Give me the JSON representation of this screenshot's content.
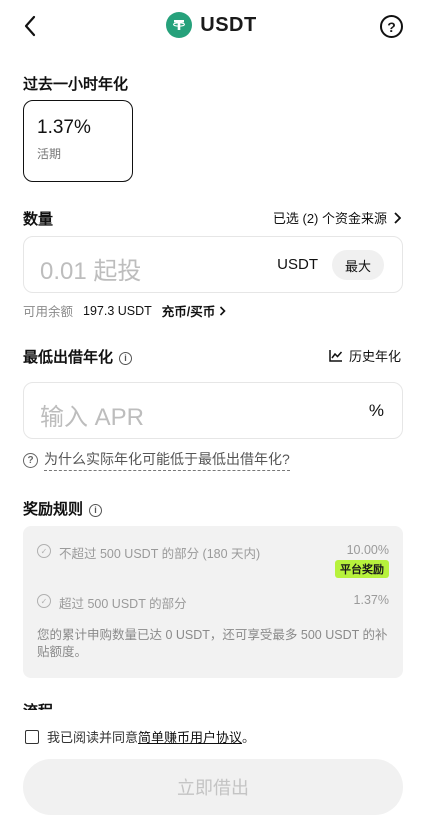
{
  "header": {
    "title": "USDT",
    "back_icon": "chevron-left-icon",
    "help_icon": "question-circle-icon",
    "help_glyph": "?",
    "coin_icon": "tether-coin-icon"
  },
  "past_hour": {
    "label": "过去一小时年化",
    "rate": "1.37%",
    "rate_type": "活期"
  },
  "amount": {
    "label": "数量",
    "sources_text": "已选 (2) 个资金来源",
    "placeholder": "0.01 起投",
    "unit": "USDT",
    "max_label": "最大",
    "balance_label": "可用余额",
    "balance_value": "197.3 USDT",
    "deposit_link": "充币/买币"
  },
  "min_apr": {
    "label": "最低出借年化",
    "history_label": "历史年化",
    "placeholder": "输入 APR",
    "percent": "%",
    "why_text": "为什么实际年化可能低于最低出借年化?"
  },
  "rewards": {
    "label": "奖励规则",
    "rows": [
      {
        "text": "不超过 500 USDT 的部分 (180 天内)",
        "value": "10.00%",
        "badge": "平台奖励"
      },
      {
        "text": "超过 500 USDT 的部分",
        "value": "1.37%"
      }
    ],
    "note": "您的累计申购数量已达 0 USDT，还可享受最多 500 USDT 的补贴额度。"
  },
  "next_section_label": "流程",
  "agreement": {
    "prefix": "我已阅读并同意",
    "link": "简单赚币用户协议",
    "suffix": "。"
  },
  "submit_label": "立即借出",
  "colors": {
    "coin": "#26a17b",
    "badge": "#b7f23c"
  }
}
